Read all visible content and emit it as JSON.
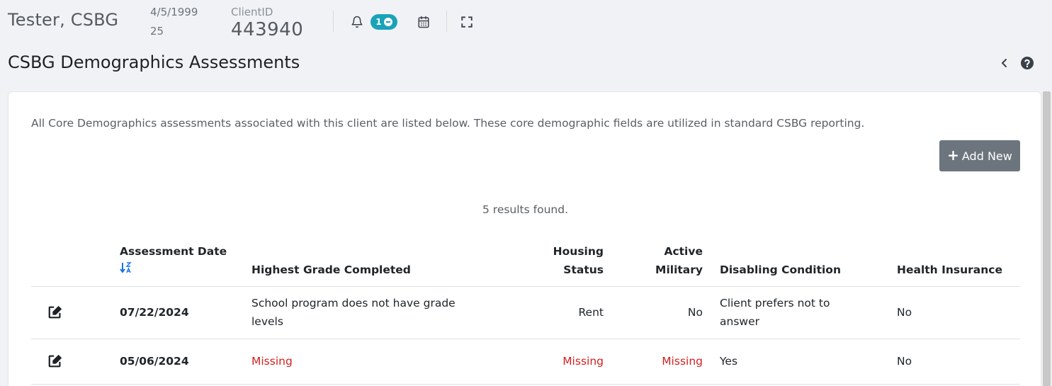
{
  "header": {
    "client_name": "Tester, CSBG",
    "dob": "4/5/1999",
    "age": "25",
    "client_id_label": "ClientID",
    "client_id": "443940",
    "notification_count": "1",
    "icons": [
      "bell-icon",
      "calendar-icon",
      "fullscreen-icon"
    ]
  },
  "page": {
    "title": "CSBG Demographics Assessments",
    "intro": "All Core Demographics assessments associated with this client are listed below. These core demographic fields are utilized in standard CSBG reporting.",
    "add_button": "Add New",
    "results": "5 results found."
  },
  "colors": {
    "accent": "#1aa3b8",
    "button": "#6c757d",
    "missing": "#d21f1f",
    "sort_icon": "#1a73e8"
  },
  "table": {
    "headers": {
      "assessment_date": "Assessment Date",
      "highest_grade": "Highest Grade Completed",
      "housing_1": "Housing",
      "housing_2": "Status",
      "military_1": "Active",
      "military_2": "Military",
      "disabling": "Disabling Condition",
      "insurance": "Health Insurance"
    },
    "rows": [
      {
        "date": "07/22/2024",
        "grade_line1": "School program does not have grade",
        "grade_line2": "levels",
        "housing": "Rent",
        "military": "No",
        "disabling_line1": "Client prefers not to",
        "disabling_line2": "answer",
        "insurance": "No"
      },
      {
        "date": "05/06/2024",
        "grade": "Missing",
        "housing": "Missing",
        "military": "Missing",
        "disabling": "Yes",
        "insurance": "No"
      }
    ]
  }
}
